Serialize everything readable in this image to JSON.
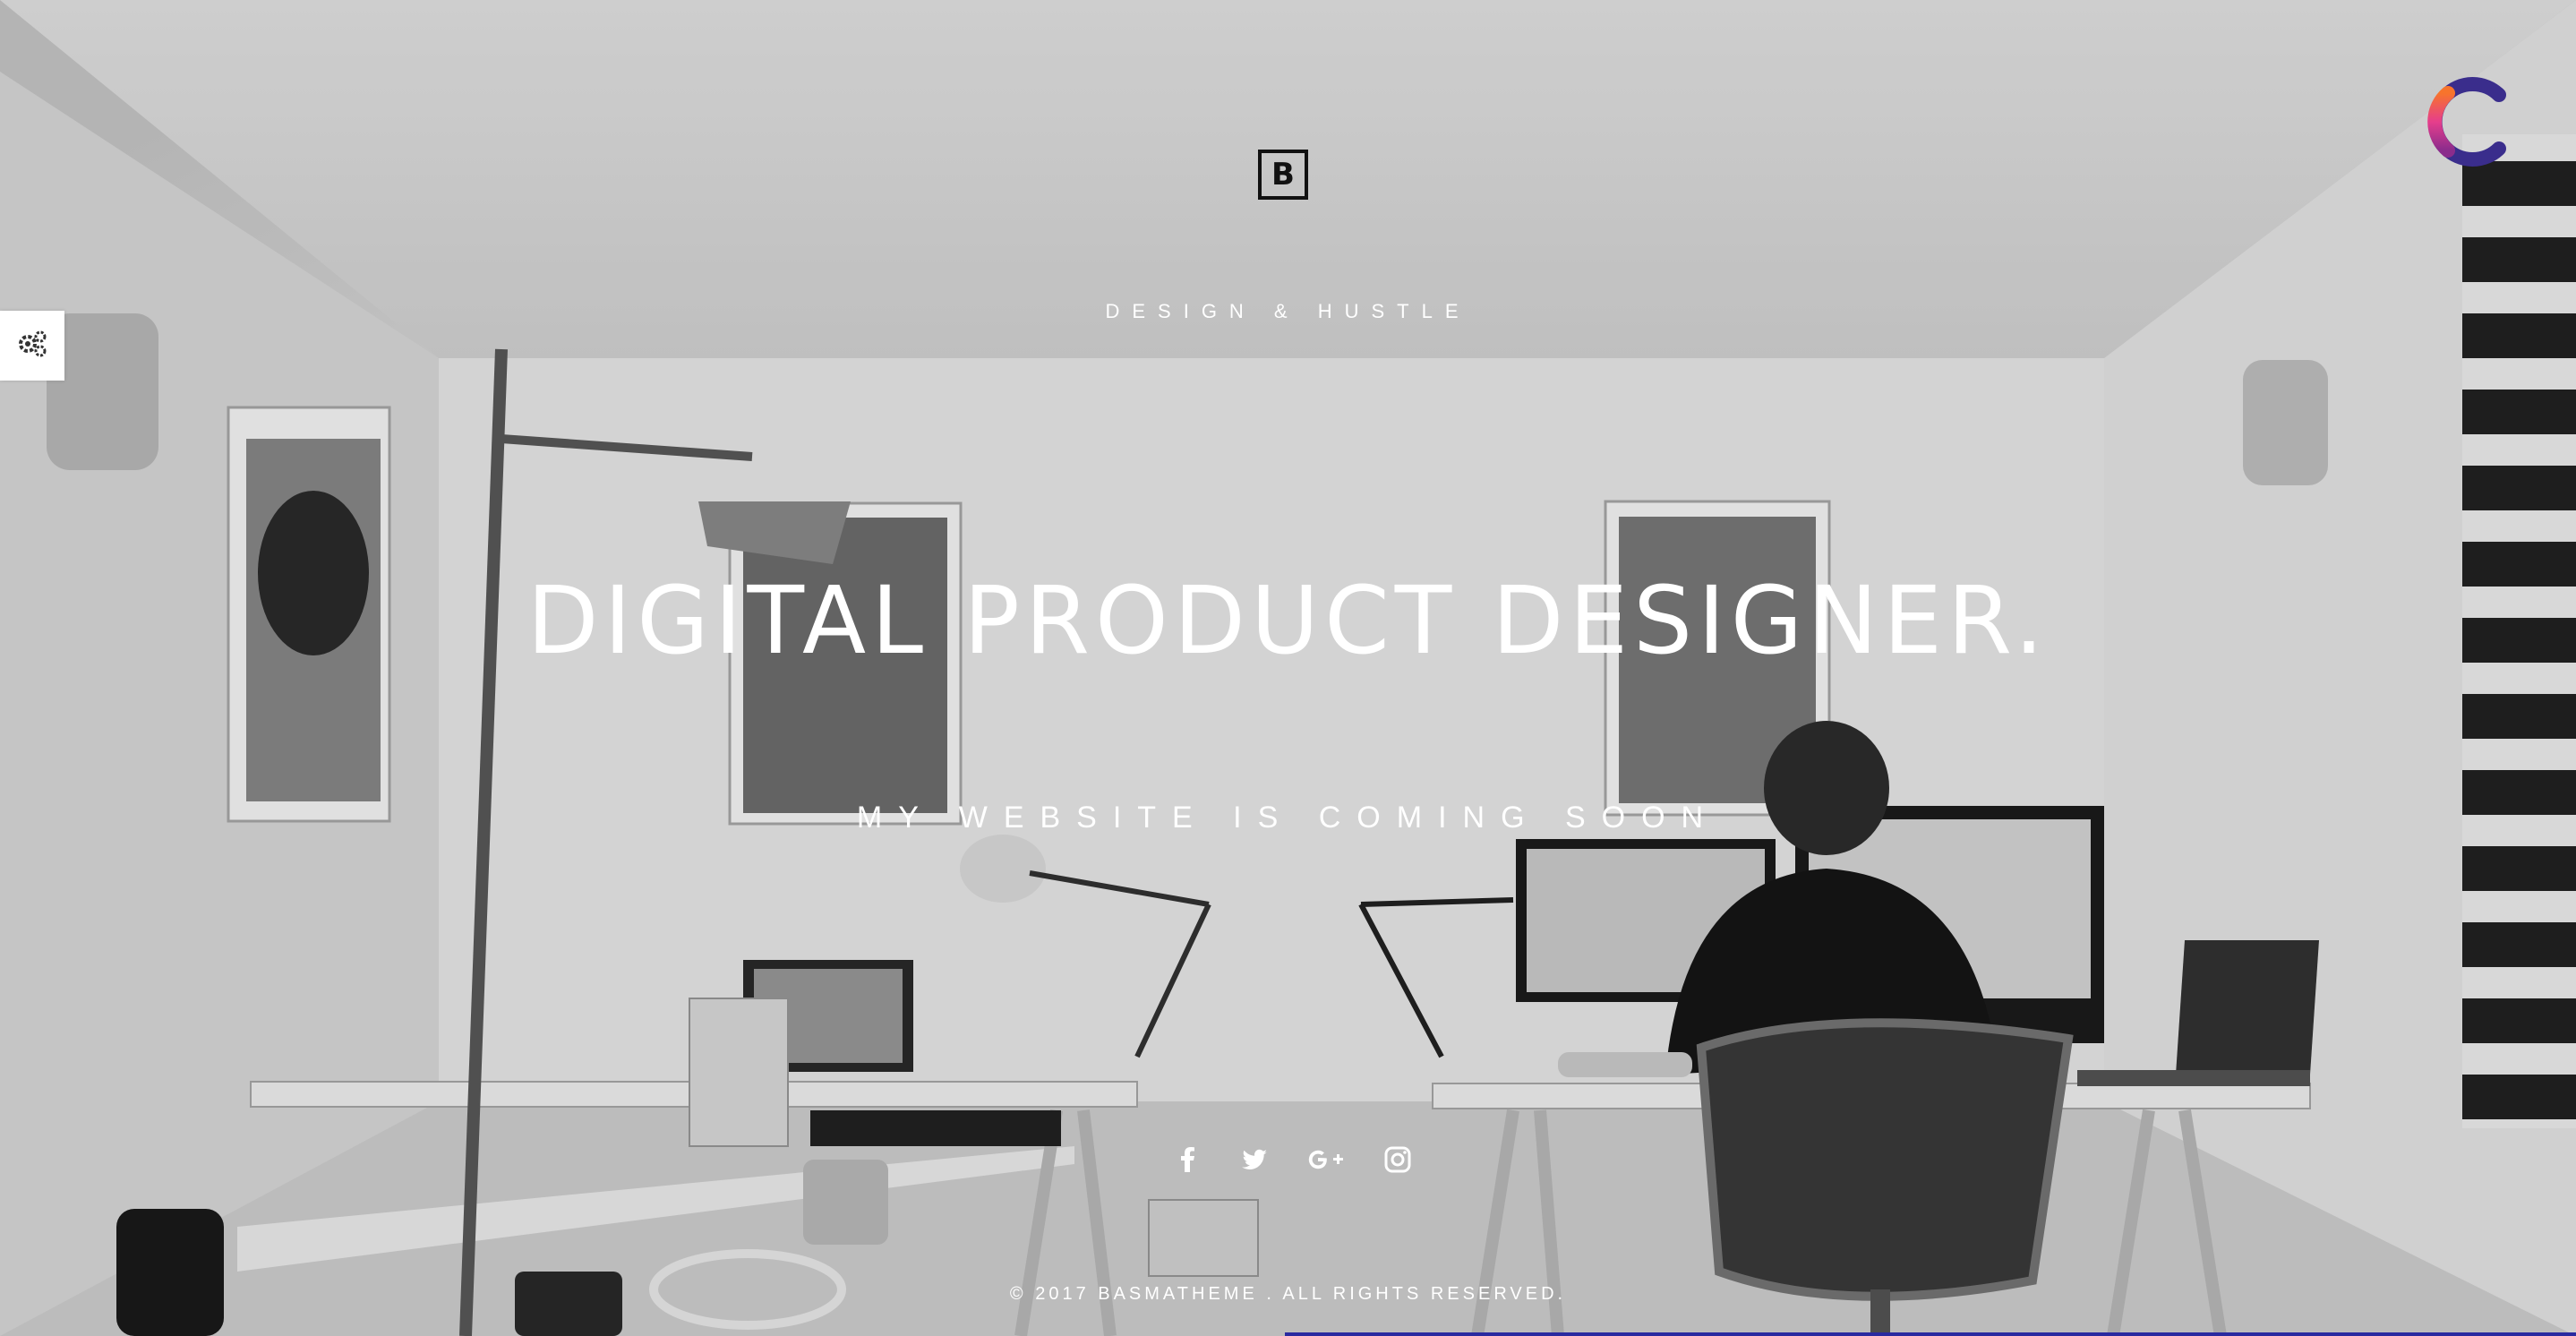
{
  "brand": {
    "logo_letter": "B"
  },
  "hero": {
    "tagline": "DESIGN & HUSTLE",
    "headline": "DIGITAL PRODUCT DESIGNER.",
    "subline": "MY WEBSITE IS COMING SOON"
  },
  "social": [
    {
      "icon": "facebook-icon"
    },
    {
      "icon": "twitter-icon"
    },
    {
      "icon": "google-plus-icon"
    },
    {
      "icon": "instagram-icon"
    }
  ],
  "footer": {
    "copyright": "© 2017 BASMATHEME . ALL RIGHTS RESERVED."
  },
  "widgets": {
    "settings_icon": "gears-icon",
    "corner_logo": "brand-c-logo"
  },
  "colors": {
    "text": "#ffffff",
    "logo": "#111111",
    "accent_orange": "#f7742c",
    "accent_pink": "#e63e8c",
    "accent_purple": "#3a2d8c"
  }
}
